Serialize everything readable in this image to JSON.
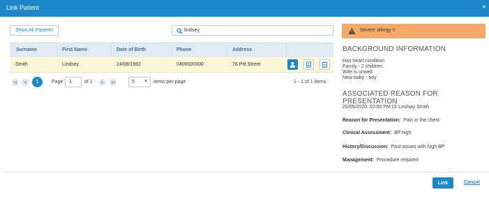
{
  "dialog": {
    "title": "Link Patient",
    "close_glyph": "×"
  },
  "toolbar": {
    "show_all_label": "Show All Patients"
  },
  "search": {
    "value": "lindsey",
    "icon": "search-icon"
  },
  "grid": {
    "columns": [
      "Surname",
      "First Name",
      "Date of Birth",
      "Phone",
      "Address"
    ],
    "rows": [
      {
        "surname": "Smith",
        "first_name": "Lindsey",
        "dob": "24/08/1992",
        "phone": "0400000000",
        "address": "76 Pitt Street"
      }
    ],
    "row_actions": [
      "person-icon",
      "id-card-icon",
      "clipboard-icon"
    ]
  },
  "pager": {
    "current_page": "1",
    "page_label": "Page",
    "page_value": "1",
    "of_label": "of 1",
    "page_size": "5",
    "items_per_page_label": "items per page",
    "summary": "1 - 1 of 1 items"
  },
  "alert": {
    "text": "Severe allergy !!",
    "icon": "warning-icon",
    "color": "#f7a968"
  },
  "background": {
    "heading": "BACKGROUND INFORMATION",
    "lines": [
      "Has heart condition",
      "Family - 2 children",
      "Wife is unwell",
      "New baby - boy"
    ]
  },
  "presentation": {
    "heading": "ASSOCIATED REASON FOR PRESENTATION",
    "meta": "20/05/2020, 02:00 PM Dr Lindsay Smith",
    "fields": [
      {
        "label": "Reason for Presentation:",
        "value": "Pain in the chest"
      },
      {
        "label": "Clinical Assessment:",
        "value": "BP high"
      },
      {
        "label": "History/Discussion:",
        "value": "Past issues with high BP"
      },
      {
        "label": "Management:",
        "value": "Procedure required"
      }
    ]
  },
  "footer": {
    "link_label": "Link",
    "cancel_label": "Cancel"
  },
  "colors": {
    "accent": "#1c87c9",
    "row_highlight": "#fcf8d7",
    "header_bg": "#e1ebf3"
  }
}
